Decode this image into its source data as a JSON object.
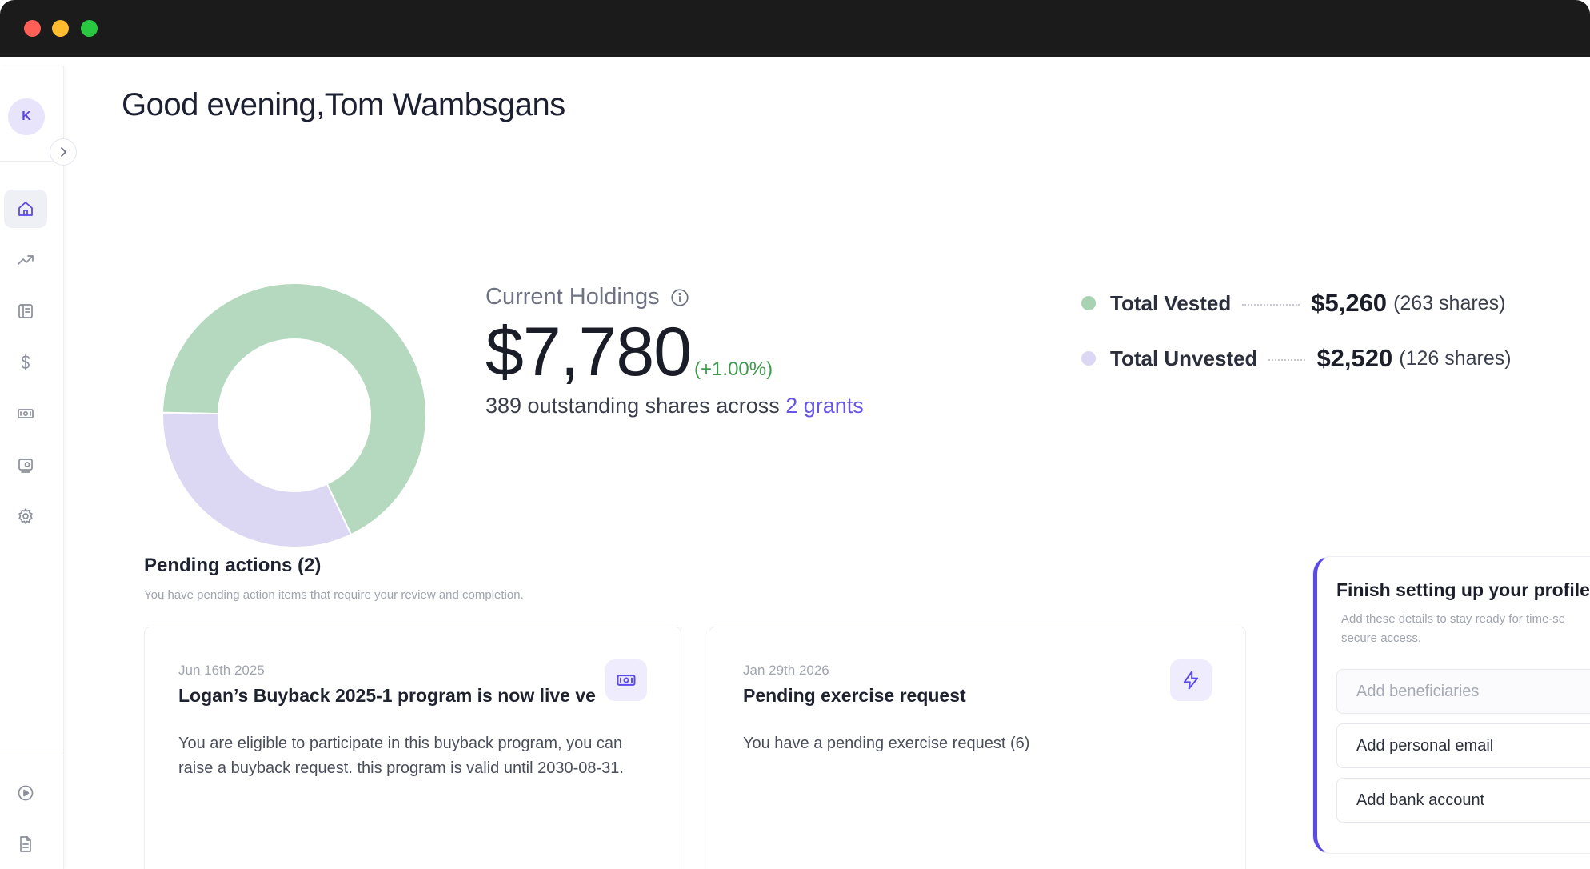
{
  "user": {
    "greeting": "Good evening,Tom Wambsgans",
    "avatar_initial": "K"
  },
  "sidebar": {
    "items": [
      {
        "name": "home",
        "icon": "home-icon",
        "active": true
      },
      {
        "name": "performance",
        "icon": "trending-up-icon",
        "active": false
      },
      {
        "name": "grants",
        "icon": "ledger-icon",
        "active": false
      },
      {
        "name": "transactions",
        "icon": "dollar-icon",
        "active": false
      },
      {
        "name": "buyback",
        "icon": "banknote-icon",
        "active": false
      },
      {
        "name": "payouts",
        "icon": "wallet-icon",
        "active": false
      },
      {
        "name": "settings",
        "icon": "gear-icon",
        "active": false
      }
    ],
    "bottom_items": [
      {
        "name": "tutorial",
        "icon": "play-circle-icon"
      },
      {
        "name": "documents",
        "icon": "document-icon"
      }
    ]
  },
  "holdings": {
    "label": "Current Holdings",
    "value": "$7,780",
    "change": "(+1.00%)",
    "summary_prefix": "389 outstanding shares across ",
    "summary_link": "2 grants"
  },
  "chart_data": {
    "type": "pie",
    "categories": [
      "Total Vested",
      "Total Unvested"
    ],
    "values": [
      5260,
      2520
    ],
    "colors": [
      "#b4d9bf",
      "#dcd7f2"
    ]
  },
  "legend": [
    {
      "label": "Total Vested",
      "value": "$5,260",
      "shares": "(263 shares)",
      "color": "#a8d3b3"
    },
    {
      "label": "Total Unvested",
      "value": "$2,520",
      "shares": "(126 shares)",
      "color": "#dcd7f2"
    }
  ],
  "pending": {
    "title": "Pending actions (2)",
    "subtitle": "You have pending action items that require your review and completion.",
    "cards": [
      {
        "date": "Jun 16th 2025",
        "title": "Logan’s Buyback 2025-1 program is now live ve",
        "description": "You are eligible to participate in this buyback program, you can raise a buyback request. this program is valid until 2030-08-31.",
        "icon": "banknote-icon"
      },
      {
        "date": "Jan 29th 2026",
        "title": "Pending exercise request",
        "description": "You have a pending exercise request (6)",
        "icon": "lightning-icon"
      }
    ]
  },
  "profile": {
    "title": "Finish setting up your profile",
    "subtitle": "Add these details to stay ready for time-se secure access.",
    "items": [
      {
        "label": "Add beneficiaries",
        "enabled": false
      },
      {
        "label": "Add personal email",
        "enabled": true
      },
      {
        "label": "Add bank account",
        "enabled": true
      }
    ]
  },
  "colors": {
    "accent": "#5b4ae8",
    "positive": "#3f9a4f",
    "link": "#6656e8"
  }
}
